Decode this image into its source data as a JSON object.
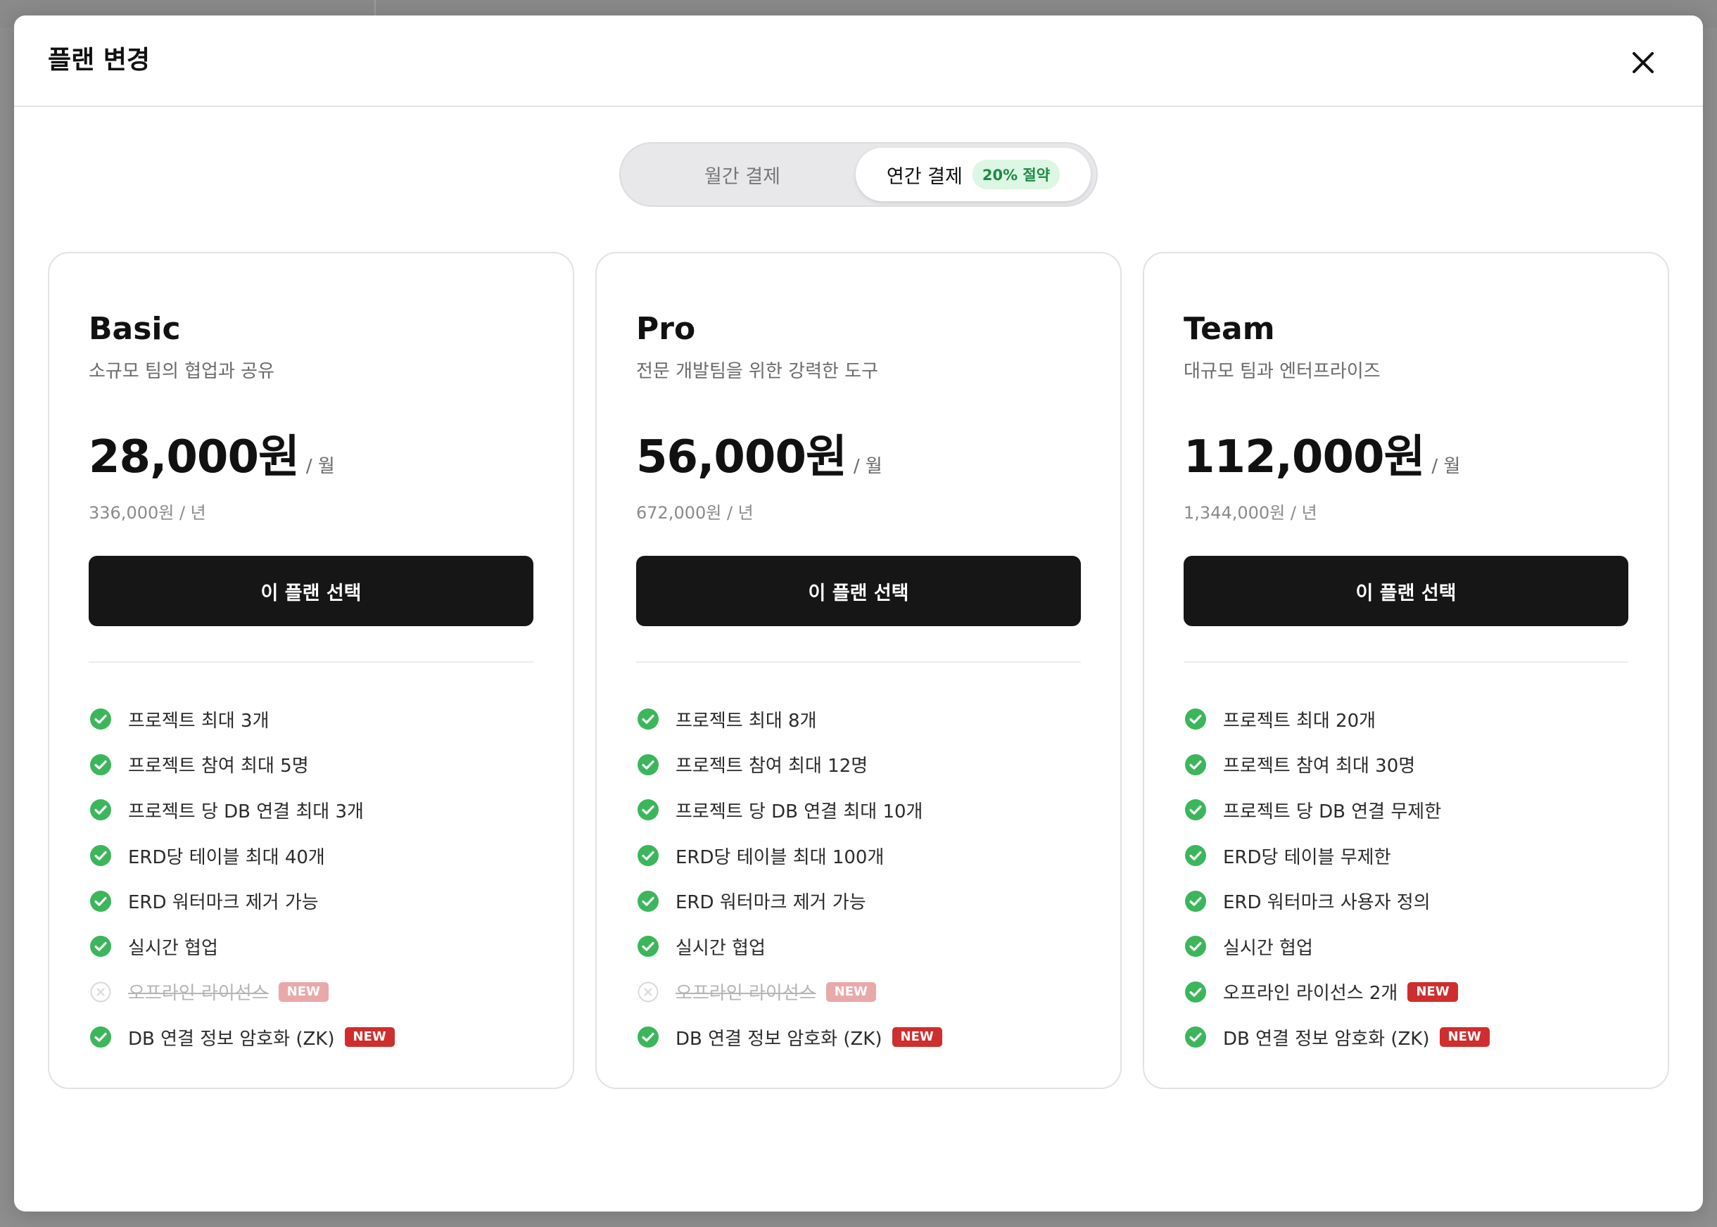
{
  "modal": {
    "title": "플랜 변경"
  },
  "billing": {
    "monthly_label": "월간 결제",
    "annual_label": "연간 결제",
    "annual_badge": "20% 절약",
    "selected": "annual"
  },
  "colors": {
    "check_green": "#3cb65b",
    "new_badge_red": "#cf2e2e",
    "button_dark": "#161616"
  },
  "plans": [
    {
      "name": "Basic",
      "description": "소규모 팀의 협업과 공유",
      "price": "28,000원",
      "period": "/ 월",
      "annual_price": "336,000원 / 년",
      "button_label": "이 플랜 선택",
      "features": [
        {
          "text": "프로젝트 최대 3개",
          "enabled": true,
          "new": false,
          "icon": "check-circle-icon"
        },
        {
          "text": "프로젝트 참여 최대 5명",
          "enabled": true,
          "new": false,
          "icon": "check-circle-icon"
        },
        {
          "text": "프로젝트 당 DB 연결 최대 3개",
          "enabled": true,
          "new": false,
          "icon": "check-circle-icon"
        },
        {
          "text": "ERD당 테이블 최대 40개",
          "enabled": true,
          "new": false,
          "icon": "check-circle-icon"
        },
        {
          "text": "ERD 워터마크 제거 가능",
          "enabled": true,
          "new": false,
          "icon": "check-circle-icon"
        },
        {
          "text": "실시간 협업",
          "enabled": true,
          "new": false,
          "icon": "check-circle-icon"
        },
        {
          "text": "오프라인 라이선스",
          "enabled": false,
          "new": true,
          "badge": "NEW",
          "icon": "x-circle-icon"
        },
        {
          "text": "DB 연결 정보 암호화 (ZK)",
          "enabled": true,
          "new": true,
          "badge": "NEW",
          "icon": "check-circle-icon"
        }
      ]
    },
    {
      "name": "Pro",
      "description": "전문 개발팀을 위한 강력한 도구",
      "price": "56,000원",
      "period": "/ 월",
      "annual_price": "672,000원 / 년",
      "button_label": "이 플랜 선택",
      "features": [
        {
          "text": "프로젝트 최대 8개",
          "enabled": true,
          "new": false,
          "icon": "check-circle-icon"
        },
        {
          "text": "프로젝트 참여 최대 12명",
          "enabled": true,
          "new": false,
          "icon": "check-circle-icon"
        },
        {
          "text": "프로젝트 당 DB 연결 최대 10개",
          "enabled": true,
          "new": false,
          "icon": "check-circle-icon"
        },
        {
          "text": "ERD당 테이블 최대 100개",
          "enabled": true,
          "new": false,
          "icon": "check-circle-icon"
        },
        {
          "text": "ERD 워터마크 제거 가능",
          "enabled": true,
          "new": false,
          "icon": "check-circle-icon"
        },
        {
          "text": "실시간 협업",
          "enabled": true,
          "new": false,
          "icon": "check-circle-icon"
        },
        {
          "text": "오프라인 라이선스",
          "enabled": false,
          "new": true,
          "badge": "NEW",
          "icon": "x-circle-icon"
        },
        {
          "text": "DB 연결 정보 암호화 (ZK)",
          "enabled": true,
          "new": true,
          "badge": "NEW",
          "icon": "check-circle-icon"
        }
      ]
    },
    {
      "name": "Team",
      "description": "대규모 팀과 엔터프라이즈",
      "price": "112,000원",
      "period": "/ 월",
      "annual_price": "1,344,000원 / 년",
      "button_label": "이 플랜 선택",
      "features": [
        {
          "text": "프로젝트 최대 20개",
          "enabled": true,
          "new": false,
          "icon": "check-circle-icon"
        },
        {
          "text": "프로젝트 참여 최대 30명",
          "enabled": true,
          "new": false,
          "icon": "check-circle-icon"
        },
        {
          "text": "프로젝트 당 DB 연결 무제한",
          "enabled": true,
          "new": false,
          "icon": "check-circle-icon"
        },
        {
          "text": "ERD당 테이블 무제한",
          "enabled": true,
          "new": false,
          "icon": "check-circle-icon"
        },
        {
          "text": "ERD 워터마크 사용자 정의",
          "enabled": true,
          "new": false,
          "icon": "check-circle-icon"
        },
        {
          "text": "실시간 협업",
          "enabled": true,
          "new": false,
          "icon": "check-circle-icon"
        },
        {
          "text": "오프라인 라이선스 2개",
          "enabled": true,
          "new": true,
          "badge": "NEW",
          "icon": "check-circle-icon"
        },
        {
          "text": "DB 연결 정보 암호화 (ZK)",
          "enabled": true,
          "new": true,
          "badge": "NEW",
          "icon": "check-circle-icon"
        }
      ]
    }
  ]
}
